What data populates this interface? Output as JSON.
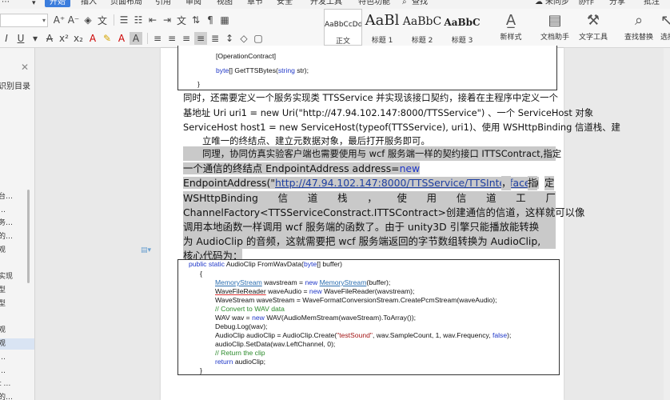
{
  "menu": {
    "items": [
      {
        "label": "开始",
        "active": true
      },
      {
        "label": "插入"
      },
      {
        "label": "页面布局"
      },
      {
        "label": "引用"
      },
      {
        "label": "审阅"
      },
      {
        "label": "视图"
      },
      {
        "label": "章节"
      },
      {
        "label": "安全"
      },
      {
        "label": "开发工具"
      },
      {
        "label": "特色功能"
      },
      {
        "label": "查找"
      }
    ],
    "right": {
      "sync": "未同步",
      "collab": "协作",
      "share": "分享",
      "comment": "批注"
    }
  },
  "ribbon": {
    "styles": [
      {
        "sample": "AaBbCcDd",
        "name": "正文"
      },
      {
        "sample": "AaBl",
        "name": "标题 1"
      },
      {
        "sample": "AaBbC",
        "name": "标题 2"
      },
      {
        "sample": "AaBbC",
        "name": "标题 3"
      }
    ],
    "tools": {
      "new_style": "新样式",
      "doc_assistant": "文档助手",
      "text_tools": "文字工具",
      "find_replace": "查找替换",
      "select": "选择"
    }
  },
  "nav": {
    "heading": "识别目录",
    "items": [
      "台…",
      "…",
      "务…",
      "的…",
      "观",
      "实现",
      "型",
      "型",
      "观",
      "观",
      "…",
      "…",
      "t …",
      "的…"
    ]
  },
  "doc": {
    "code_top": {
      "line1": "[OperationContract]",
      "line2_kw": "byte",
      "line2_rest": "[] GetTTSBytes(",
      "line2_kw2": "string",
      "line2_end": " str);",
      "line3": "}"
    },
    "para1": {
      "l1": "同时，还需要定义一个服务实现类 TTSService 并实现该接口契约，接着在主程序中定义一个",
      "l2": "基地址 Uri uri1 = new Uri(\"http://47.94.102.147:8000/TTSService\") 、一个 ServiceHost 对象",
      "l3": "ServiceHost host1 = new ServiceHost(typeof(TTSService), uri1)、使用 WSHttpBinding 信道栈、建",
      "l4": "立唯一的终结点、建立元数据对象，最后打开服务即可。"
    },
    "para2": {
      "l1": "同理，协同仿真实验客户端也需要使用与 wcf 服务端一样的契约接口 ITTSContract,指定",
      "l2a": "一个通信的终结点 EndpointAddress address=",
      "l2b": "new",
      "l3a": "EndpointAddress(\"",
      "l3b": "http://47.94.102.147:8000/TTSService/TTSInterface",
      "l3c": "\")",
      "l3d": "，",
      "l3e": "指",
      "l3f": "定",
      "l4": [
        "WSHttpBinding",
        "信",
        "道",
        "栈",
        "，",
        "使",
        "用",
        "信",
        "道",
        "工",
        "厂"
      ],
      "l5": "ChannelFactory<TTSServiceConstract.ITTSContract>创建通信的信道，这样就可以像",
      "l6": "调用本地函数一样调用 wcf 服务端的函数了。由于 unity3D 引擎只能播放能转换",
      "l7": "为 AudioClip 的音频，这就需要把 wcf 服务端返回的字节数组转换为 AudioClip,",
      "l8": "核心代码为："
    },
    "code_bottom": {
      "sig_kw": "public static",
      "sig_rest": " AudioClip FromWavData(",
      "sig_kw2": "byte",
      "sig_end": "[] buffer)",
      "open": "{",
      "l1a": "MemoryStream",
      "l1b": " wavstream = ",
      "l1c": "new",
      "l1d": " ",
      "l1e": "MemoryStream",
      "l1f": "(buffer);",
      "l2a": "WaveFileReader",
      "l2b": " waveAudio = ",
      "l2c": "new",
      "l2d": " WaveFileReader(wavstream);",
      "l3": "WaveStream waveStream = WaveFormatConversionStream.CreatePcmStream(waveAudio);",
      "l4": "// Convert to WAV data",
      "l5a": "WAV wav = ",
      "l5b": "new",
      "l5c": " WAV(AudioMemStream(waveStream).ToArray());",
      "l6": "Debug.Log(wav);",
      "l7a": "AudioClip audioClip = AudioClip.Create(",
      "l7b": "\"testSound\"",
      "l7c": ", wav.SampleCount, 1, wav.Frequency, ",
      "l7d": "false",
      "l7e": ");",
      "l8": "audioClip.SetData(wav.LeftChannel, 0);",
      "l9": "// Return the clip",
      "l10a": "return",
      "l10b": " audioClip;",
      "close": "}"
    }
  },
  "colors": {
    "accent": "#3b7ddd",
    "keyword": "#1f37c8",
    "comment": "#2b8a2b",
    "string": "#a31515",
    "selection": "#c9c9c9"
  }
}
